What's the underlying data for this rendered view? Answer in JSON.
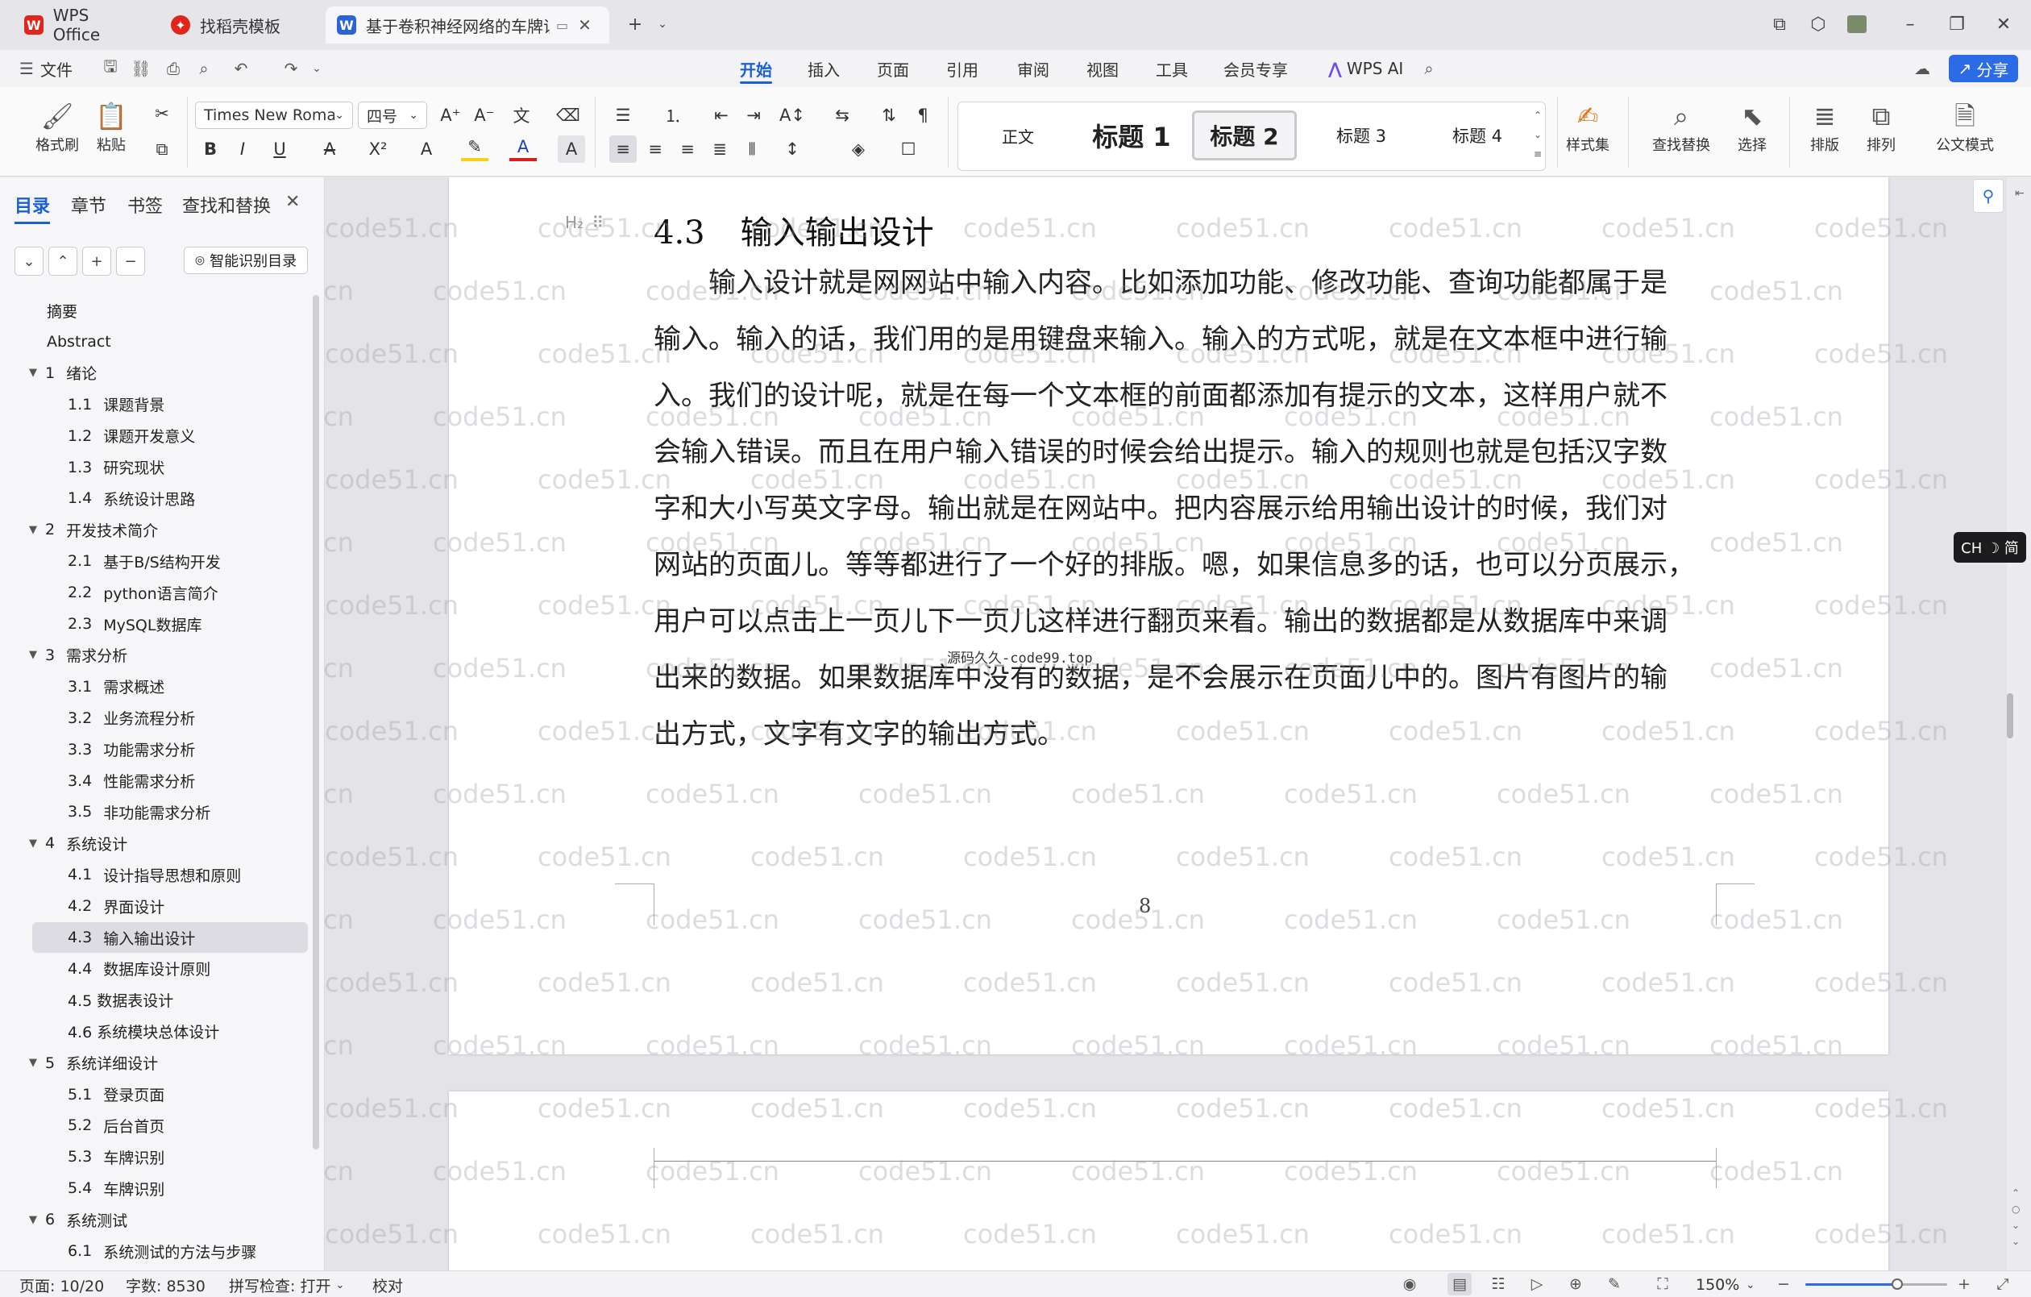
{
  "titlebar": {
    "tabs": [
      {
        "label": "WPS Office",
        "logo": "W",
        "color": "#e0261b"
      },
      {
        "label": "找稻壳模板",
        "logo": "稻",
        "color": "#e0261b"
      },
      {
        "label": "基于卷积神经网络的车牌识别",
        "logo": "W",
        "color": "#2b64d9"
      }
    ],
    "new_tab": "+"
  },
  "menubar": {
    "file": "文件",
    "items": [
      "开始",
      "插入",
      "页面",
      "引用",
      "审阅",
      "视图",
      "工具",
      "会员专享",
      "WPS AI"
    ],
    "share": "分享"
  },
  "ribbon": {
    "format_painter": "格式刷",
    "paste": "粘贴",
    "font_name": "Times New Romar",
    "font_size": "四号",
    "styles": [
      {
        "label": "正文",
        "size": 20
      },
      {
        "label": "标题 1",
        "size": 32
      },
      {
        "label": "标题 2",
        "size": 28
      },
      {
        "label": "标题 3",
        "size": 21
      },
      {
        "label": "标题 4",
        "size": 21
      }
    ],
    "style_set": "样式集",
    "find_replace": "查找替换",
    "select": "选择",
    "layout": "排版",
    "arrange": "排列",
    "official_mode": "公文模式"
  },
  "nav": {
    "tabs": [
      "目录",
      "章节",
      "书签",
      "查找和替换"
    ],
    "smart_toc": "智能识别目录",
    "items": [
      {
        "num": "",
        "text": "摘要",
        "level": 0,
        "expand": ""
      },
      {
        "num": "",
        "text": "Abstract",
        "level": 0,
        "expand": ""
      },
      {
        "num": "1",
        "text": "绪论",
        "level": 0,
        "expand": "▼"
      },
      {
        "num": "1.1",
        "text": "课题背景",
        "level": 1,
        "expand": ""
      },
      {
        "num": "1.2",
        "text": "课题开发意义",
        "level": 1,
        "expand": ""
      },
      {
        "num": "1.3",
        "text": "研究现状",
        "level": 1,
        "expand": ""
      },
      {
        "num": "1.4",
        "text": "系统设计思路",
        "level": 1,
        "expand": ""
      },
      {
        "num": "2",
        "text": "开发技术简介",
        "level": 0,
        "expand": "▼"
      },
      {
        "num": "2.1",
        "text": "基于B/S结构开发",
        "level": 1,
        "expand": ""
      },
      {
        "num": "2.2",
        "text": "python语言简介",
        "level": 1,
        "expand": ""
      },
      {
        "num": "2.3",
        "text": "MySQL数据库",
        "level": 1,
        "expand": ""
      },
      {
        "num": "3",
        "text": "需求分析",
        "level": 0,
        "expand": "▼"
      },
      {
        "num": "3.1",
        "text": "需求概述",
        "level": 1,
        "expand": ""
      },
      {
        "num": "3.2",
        "text": "业务流程分析",
        "level": 1,
        "expand": ""
      },
      {
        "num": "3.3",
        "text": "功能需求分析",
        "level": 1,
        "expand": ""
      },
      {
        "num": "3.4",
        "text": "性能需求分析",
        "level": 1,
        "expand": ""
      },
      {
        "num": "3.5",
        "text": "非功能需求分析",
        "level": 1,
        "expand": ""
      },
      {
        "num": "4",
        "text": "系统设计",
        "level": 0,
        "expand": "▼"
      },
      {
        "num": "4.1",
        "text": "设计指导思想和原则",
        "level": 1,
        "expand": ""
      },
      {
        "num": "4.2",
        "text": "界面设计",
        "level": 1,
        "expand": ""
      },
      {
        "num": "4.3",
        "text": "输入输出设计",
        "level": 1,
        "expand": ""
      },
      {
        "num": "4.4",
        "text": "数据库设计原则",
        "level": 1,
        "expand": ""
      },
      {
        "num": "",
        "text": "4.5 数据表设计",
        "level": 1,
        "expand": ""
      },
      {
        "num": "",
        "text": "4.6 系统模块总体设计",
        "level": 1,
        "expand": ""
      },
      {
        "num": "5",
        "text": "系统详细设计",
        "level": 0,
        "expand": "▼"
      },
      {
        "num": "5.1",
        "text": "登录页面",
        "level": 1,
        "expand": ""
      },
      {
        "num": "5.2",
        "text": "后台首页",
        "level": 1,
        "expand": ""
      },
      {
        "num": "5.3",
        "text": "车牌识别",
        "level": 1,
        "expand": ""
      },
      {
        "num": "5.4",
        "text": "车牌识别",
        "level": 1,
        "expand": ""
      },
      {
        "num": "6",
        "text": "系统测试",
        "level": 0,
        "expand": "▼"
      },
      {
        "num": "6.1",
        "text": "系统测试的方法与步骤",
        "level": 1,
        "expand": ""
      }
    ],
    "selected_index": 20
  },
  "document": {
    "heading_marker": "H₂",
    "heading_num": "4.3",
    "heading_text": "输入输出设计",
    "lines": [
      "输入设计就是网网站中输入内容。比如添加功能、修改功能、查询功能都属于是",
      "输入。输入的话，我们用的是用键盘来输入。输入的方式呢，就是在文本框中进行输",
      "入。我们的设计呢，就是在每一个文本框的前面都添加有提示的文本，这样用户就不",
      "会输入错误。而且在用户输入错误的时候会给出提示。输入的规则也就是包括汉字数",
      "字和大小写英文字母。输出就是在网站中。把内容展示给用输出设计的时候，我们对",
      "网站的页面儿。等等都进行了一个好的排版。嗯，如果信息多的话，也可以分页展示，",
      "用户可以点击上一页儿下一页儿这样进行翻页来看。输出的数据都是从数据库中来调",
      "出来的数据。如果数据库中没有的数据，是不会展示在页面儿中的。图片有图片的输",
      "出方式，文字有文字的输出方式。"
    ],
    "overlay_text": "源码久久-code99.top",
    "page_number": "8",
    "watermark": "code51.cn"
  },
  "ime_badge": "CH ☽ 简",
  "statusbar": {
    "page": "页面: 10/20",
    "words": "字数: 8530",
    "spell": "拼写检查: 打开",
    "proof": "校对",
    "zoom": "150%",
    "zoom_fraction": 0.65
  },
  "colors": {
    "accent": "#1a5fd8",
    "wps_red": "#e0261b"
  }
}
